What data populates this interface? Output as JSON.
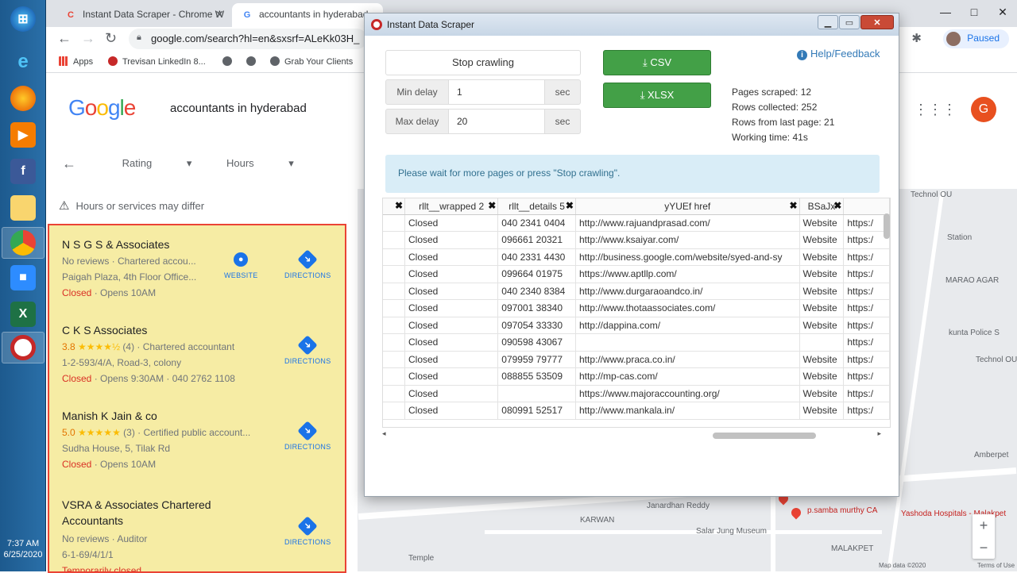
{
  "taskbar": {
    "clock_time": "7:37 AM",
    "clock_date": "6/25/2020"
  },
  "browser": {
    "tabs": [
      {
        "title": "Instant Data Scraper - Chrome W",
        "favicon": "C"
      },
      {
        "title": "accountants in hyderabad",
        "favicon": "G"
      }
    ],
    "url": "google.com/search?hl=en&sxsrf=ALeKk03H_",
    "profile_label": "Paused",
    "bookmarks": [
      "Apps",
      "Trevisan LinkedIn 8...",
      "Grab Your Clients"
    ]
  },
  "google": {
    "logo": "Google",
    "query": "accountants in hyderabad",
    "avatar_letter": "G",
    "filters": [
      "Rating",
      "Hours"
    ],
    "warning": "Hours or services may differ",
    "results": [
      {
        "name": "N S G S & Associates",
        "line1": "No reviews · Chartered accou...",
        "line2": "Paigah Plaza, 4th Floor Office...",
        "status": "Closed",
        "status_rest": " · Opens 10AM",
        "actions": [
          "WEBSITE",
          "DIRECTIONS"
        ]
      },
      {
        "name": "C K S Associates",
        "rating": "3.8",
        "stars": "★★★★½",
        "reviews_and_type": "(4) · Chartered accountant",
        "line2": "1-2-593/4/A, Road-3, colony",
        "status": "Closed",
        "status_rest": " · Opens 9:30AM · 040 2762 1108",
        "actions": [
          "DIRECTIONS"
        ]
      },
      {
        "name": "Manish K Jain & co",
        "rating": "5.0",
        "stars": "★★★★★",
        "reviews_and_type": "(3) · Certified public account...",
        "line2": "Sudha House, 5, Tilak Rd",
        "status": "Closed",
        "status_rest": " · Opens 10AM",
        "actions": [
          "DIRECTIONS"
        ]
      },
      {
        "name": "VSRA & Associates Chartered Accountants",
        "line1": "No reviews · Auditor",
        "line2": "6-1-69/4/1/1",
        "status": "Temporarily closed",
        "actions": [
          "DIRECTIONS"
        ]
      }
    ]
  },
  "map": {
    "labels": [
      "Janardhan Reddy",
      "p.samba murthy CA",
      "KARWAN",
      "Salar Jung Museum",
      "Yashoda Hospitals - Malakpet",
      "MALAKPET",
      "Amberpet",
      "Technol OU",
      "MARAO AGAR",
      "Station",
      "kunta Police S",
      "Temple",
      "Map data ©2020",
      "Terms of Use"
    ]
  },
  "scraper": {
    "window_title": "Instant Data Scraper",
    "stop_label": "Stop crawling",
    "min_delay_label": "Min delay",
    "min_delay_value": "1",
    "max_delay_label": "Max delay",
    "max_delay_value": "20",
    "sec_label": "sec",
    "csv_label": "CSV",
    "xlsx_label": "XLSX",
    "help_label": "Help/Feedback",
    "stats": {
      "pages_scraped": "Pages scraped: 12",
      "rows_collected": "Rows collected: 252",
      "rows_last_page": "Rows from last page: 21",
      "working_time": "Working time: 41s"
    },
    "notice": "Please wait for more pages or press \"Stop crawling\".",
    "columns": [
      "",
      "rllt__wrapped 2",
      "rllt__details 5",
      "yYUEf href",
      "BSaJx",
      ""
    ],
    "rows": [
      [
        "",
        "Closed",
        "040 2341 0404",
        "http://www.rajuandprasad.com/",
        "Website",
        "https:/"
      ],
      [
        "",
        "Closed",
        "096661 20321",
        "http://www.ksaiyar.com/",
        "Website",
        "https:/"
      ],
      [
        "",
        "Closed",
        "040 2331 4430",
        "http://business.google.com/website/syed-and-sy",
        "Website",
        "https:/"
      ],
      [
        "",
        "Closed",
        "099664 01975",
        "https://www.aptllp.com/",
        "Website",
        "https:/"
      ],
      [
        "",
        "Closed",
        "040 2340 8384",
        "http://www.durgaraoandco.in/",
        "Website",
        "https:/"
      ],
      [
        "",
        "Closed",
        "097001 38340",
        "http://www.thotaassociates.com/",
        "Website",
        "https:/"
      ],
      [
        "",
        "Closed",
        "097054 33330",
        "http://dappina.com/",
        "Website",
        "https:/"
      ],
      [
        "",
        "Closed",
        "090598 43067",
        "",
        "",
        "https:/"
      ],
      [
        "",
        "Closed",
        "079959 79777",
        "http://www.praca.co.in/",
        "Website",
        "https:/"
      ],
      [
        "",
        "Closed",
        "088855 53509",
        "http://mp-cas.com/",
        "Website",
        "https:/"
      ],
      [
        "",
        "Closed",
        "",
        "https://www.majoraccounting.org/",
        "Website",
        "https:/"
      ],
      [
        "",
        "Closed",
        "080991 52517",
        "http://www.mankala.in/",
        "Website",
        "https:/"
      ]
    ]
  }
}
